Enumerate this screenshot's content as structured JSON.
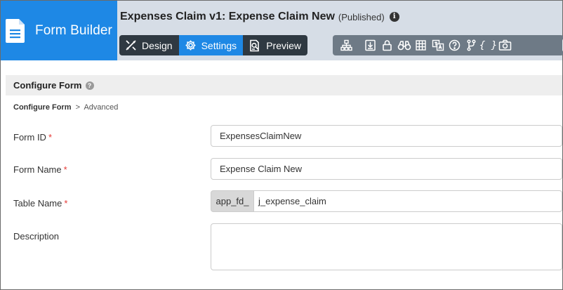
{
  "brand": {
    "title": "Form Builder",
    "color": "#1e88e5"
  },
  "header": {
    "form_name": "Expenses Claim v1: Expense Claim New",
    "status": "(Published)",
    "info_glyph": "i"
  },
  "tabs": [
    {
      "label": "Design",
      "icon": "design-tools-icon",
      "active": false
    },
    {
      "label": "Settings",
      "icon": "gear-icon",
      "active": true
    },
    {
      "label": "Preview",
      "icon": "preview-document-icon",
      "active": false
    }
  ],
  "toolbar": {
    "tools": [
      "hierarchy-icon",
      "export-icon",
      "lock-icon",
      "binoculars-icon",
      "grid-icon",
      "translate-icon",
      "help-icon",
      "branch-icon",
      "braces-icon",
      "camera-icon"
    ],
    "braces_glyph": "{ }",
    "scroll_glyph": "›"
  },
  "section": {
    "title": "Configure Form",
    "help_glyph": "?"
  },
  "breadcrumb": {
    "current": "Configure Form",
    "separator": ">",
    "next": "Advanced"
  },
  "fields": {
    "form_id": {
      "label": "Form ID",
      "required": "*",
      "value": "ExpensesClaimNew"
    },
    "form_name": {
      "label": "Form Name",
      "required": "*",
      "value": "Expense Claim New"
    },
    "table_name": {
      "label": "Table Name",
      "required": "*",
      "prefix": "app_fd_",
      "value": "j_expense_claim"
    },
    "description": {
      "label": "Description",
      "value": ""
    }
  },
  "colors": {
    "accent": "#1e88e5",
    "dark_tab": "#2f3942",
    "toolbar": "#6e7a86",
    "topbar": "#d6dde6",
    "required": "#e53935"
  }
}
